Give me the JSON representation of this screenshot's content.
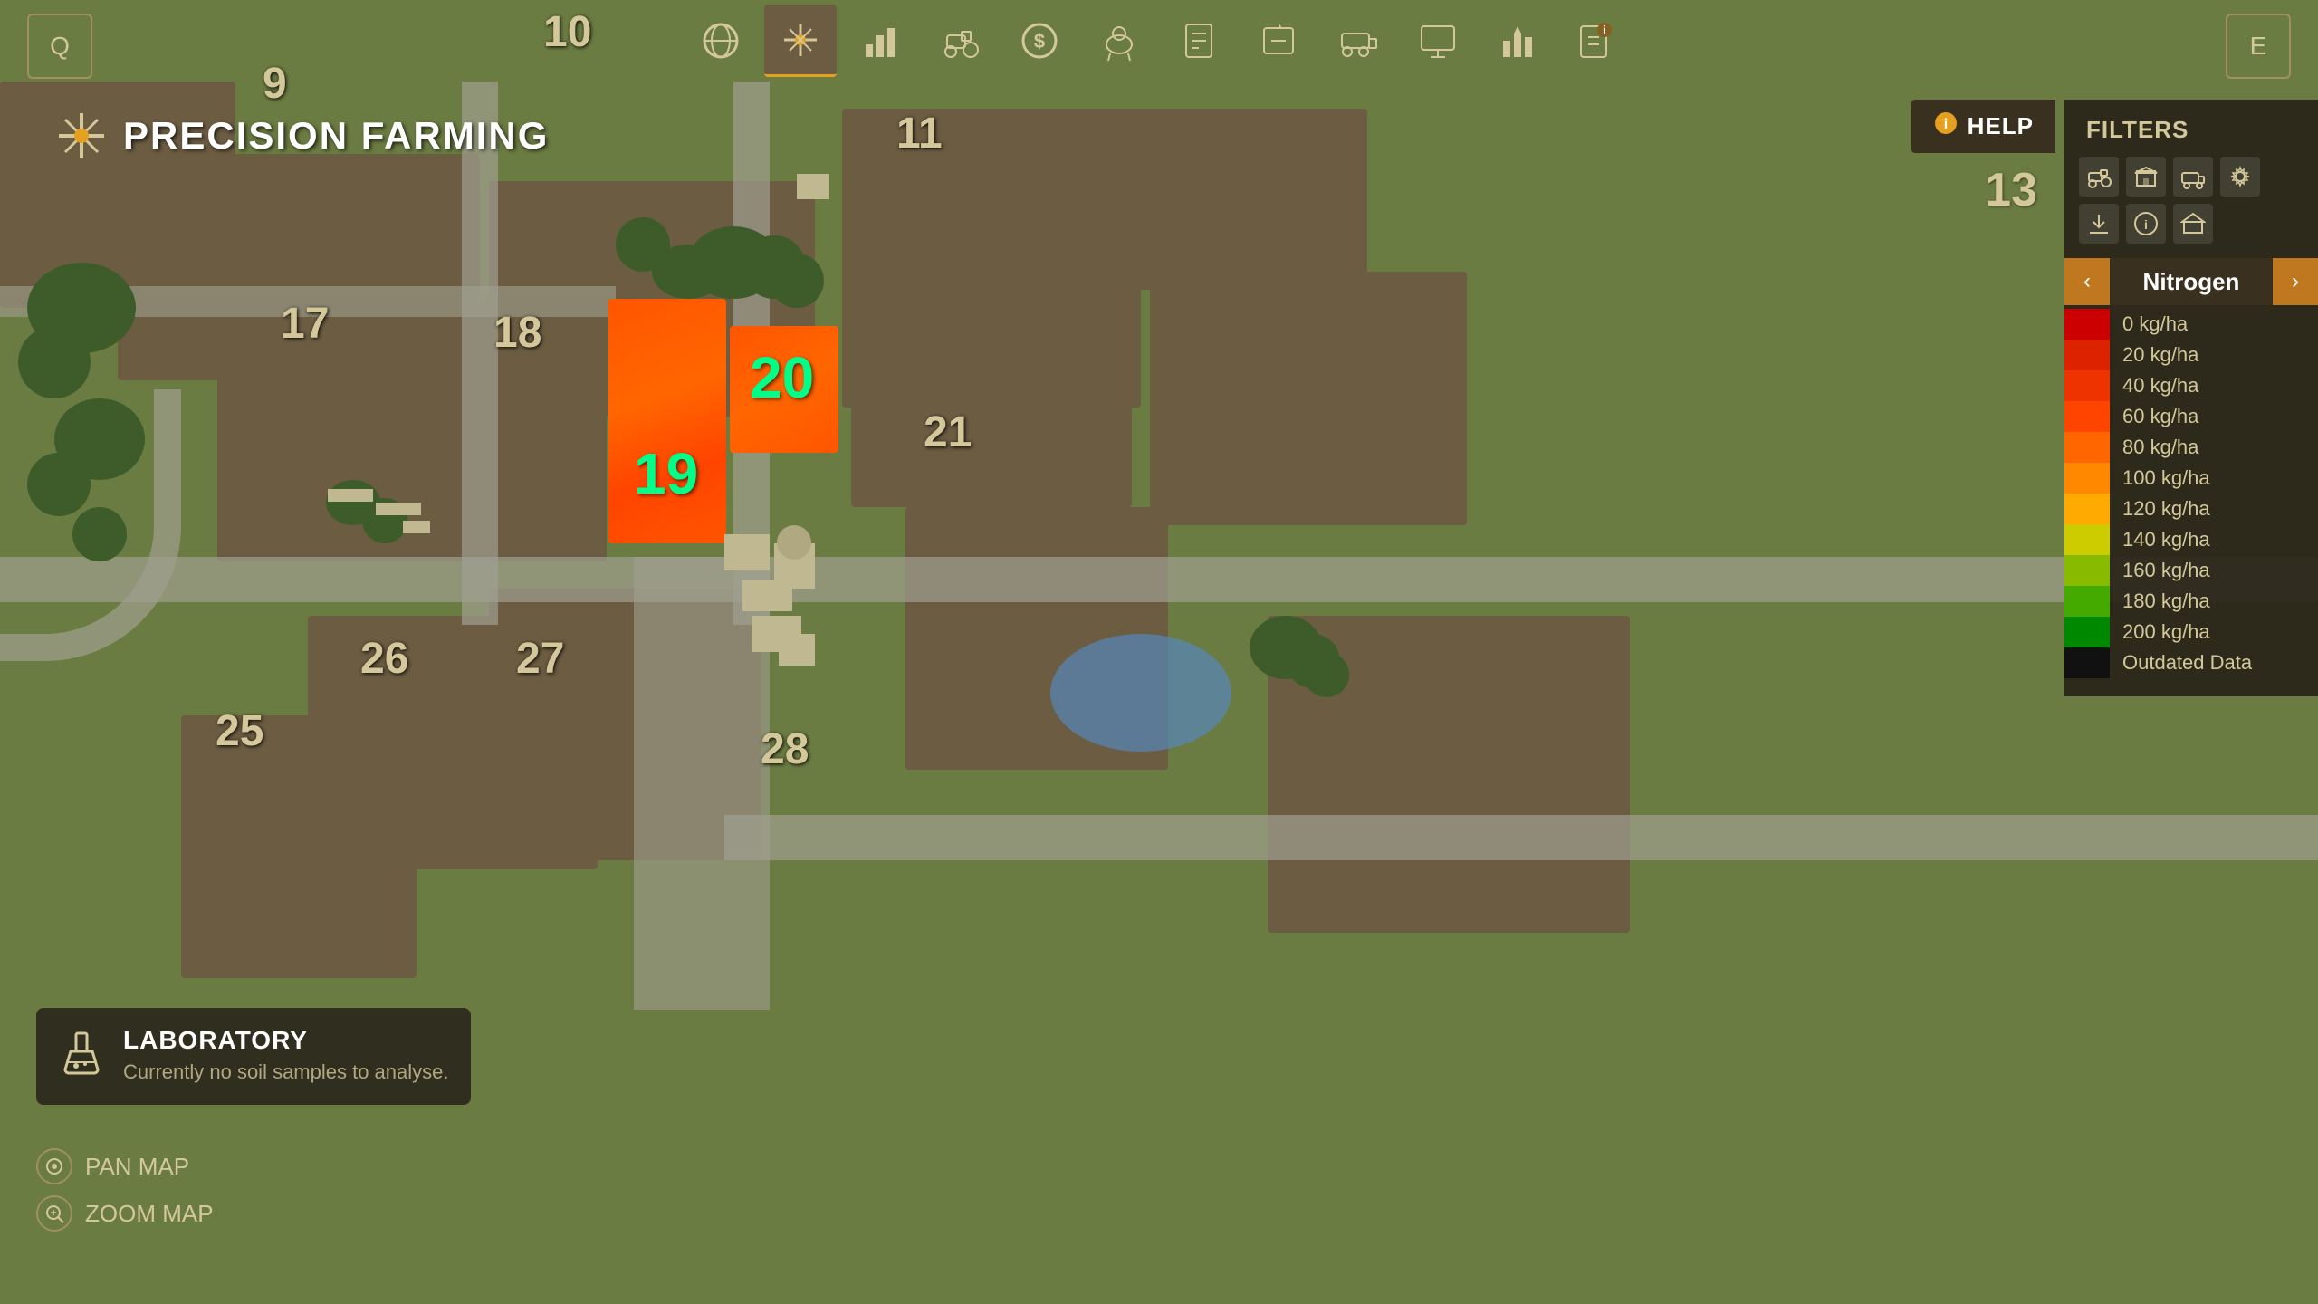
{
  "app": {
    "q_label": "Q",
    "e_label": "E"
  },
  "title": {
    "text": "PRECISION FARMING"
  },
  "nav": {
    "items": [
      {
        "id": "map",
        "label": "🌐",
        "active": false
      },
      {
        "id": "precision",
        "label": "⛏",
        "active": true
      },
      {
        "id": "stats",
        "label": "📊",
        "active": false
      },
      {
        "id": "tractor",
        "label": "🚜",
        "active": false
      },
      {
        "id": "finance",
        "label": "💰",
        "active": false
      },
      {
        "id": "animals",
        "label": "🐄",
        "active": false
      },
      {
        "id": "contracts",
        "label": "📋",
        "active": false
      },
      {
        "id": "missions",
        "label": "📌",
        "active": false
      },
      {
        "id": "vehicle2",
        "label": "🚛",
        "active": false
      },
      {
        "id": "monitor",
        "label": "🖥",
        "active": false
      },
      {
        "id": "leaderboard",
        "label": "🏆",
        "active": false
      },
      {
        "id": "info",
        "label": "ℹ",
        "active": false
      }
    ]
  },
  "filters": {
    "title": "FILTERS",
    "icons": [
      "🚜",
      "🏠",
      "🚛",
      "⚙",
      "⬇",
      "ℹ",
      "🏠"
    ],
    "nitrogen_label": "Nitrogen",
    "legend": [
      {
        "label": "0 kg/ha",
        "color": "#cc0000"
      },
      {
        "label": "20 kg/ha",
        "color": "#dd2200"
      },
      {
        "label": "40 kg/ha",
        "color": "#ee3300"
      },
      {
        "label": "60 kg/ha",
        "color": "#ff4400"
      },
      {
        "label": "80 kg/ha",
        "color": "#ff6600"
      },
      {
        "label": "100 kg/ha",
        "color": "#ff8800"
      },
      {
        "label": "120 kg/ha",
        "color": "#ffaa00"
      },
      {
        "label": "140 kg/ha",
        "color": "#cccc00"
      },
      {
        "label": "160 kg/ha",
        "color": "#88bb00"
      },
      {
        "label": "180 kg/ha",
        "color": "#44aa00"
      },
      {
        "label": "200 kg/ha",
        "color": "#008800"
      },
      {
        "label": "Outdated Data",
        "color": "#111111"
      }
    ]
  },
  "help": {
    "label": "HELP"
  },
  "laboratory": {
    "title": "LABORATORY",
    "subtitle": "Currently no soil samples to analyse."
  },
  "controls": {
    "pan": "PAN MAP",
    "zoom": "ZOOM MAP"
  },
  "field_numbers": {
    "f9": "9",
    "f10": "10",
    "f11": "11",
    "f13": "13",
    "f17": "17",
    "f18": "18",
    "f19": "19",
    "f20": "20",
    "f21": "21",
    "f25": "25",
    "f26": "26",
    "f27": "27",
    "f28": "28"
  }
}
